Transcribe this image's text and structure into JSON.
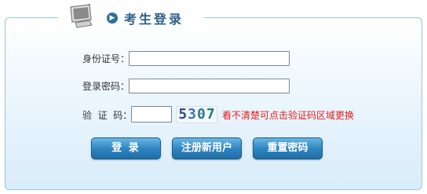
{
  "header": {
    "title": "考生登录"
  },
  "form": {
    "id_label": "身份证号：",
    "id_value": "",
    "password_label": "登录密码：",
    "password_value": "",
    "captcha_label": "验  证  码：",
    "captcha_value": "",
    "captcha_digits": [
      "5",
      "3",
      "0",
      "7"
    ],
    "captcha_hint": "看不清楚可点击验证码区域更换"
  },
  "buttons": {
    "login": "登 录",
    "register": "注册新用户",
    "reset_password": "重置密码"
  },
  "colors": {
    "accent": "#2e86c1",
    "title": "#2d5f86",
    "hint": "#e02020"
  }
}
